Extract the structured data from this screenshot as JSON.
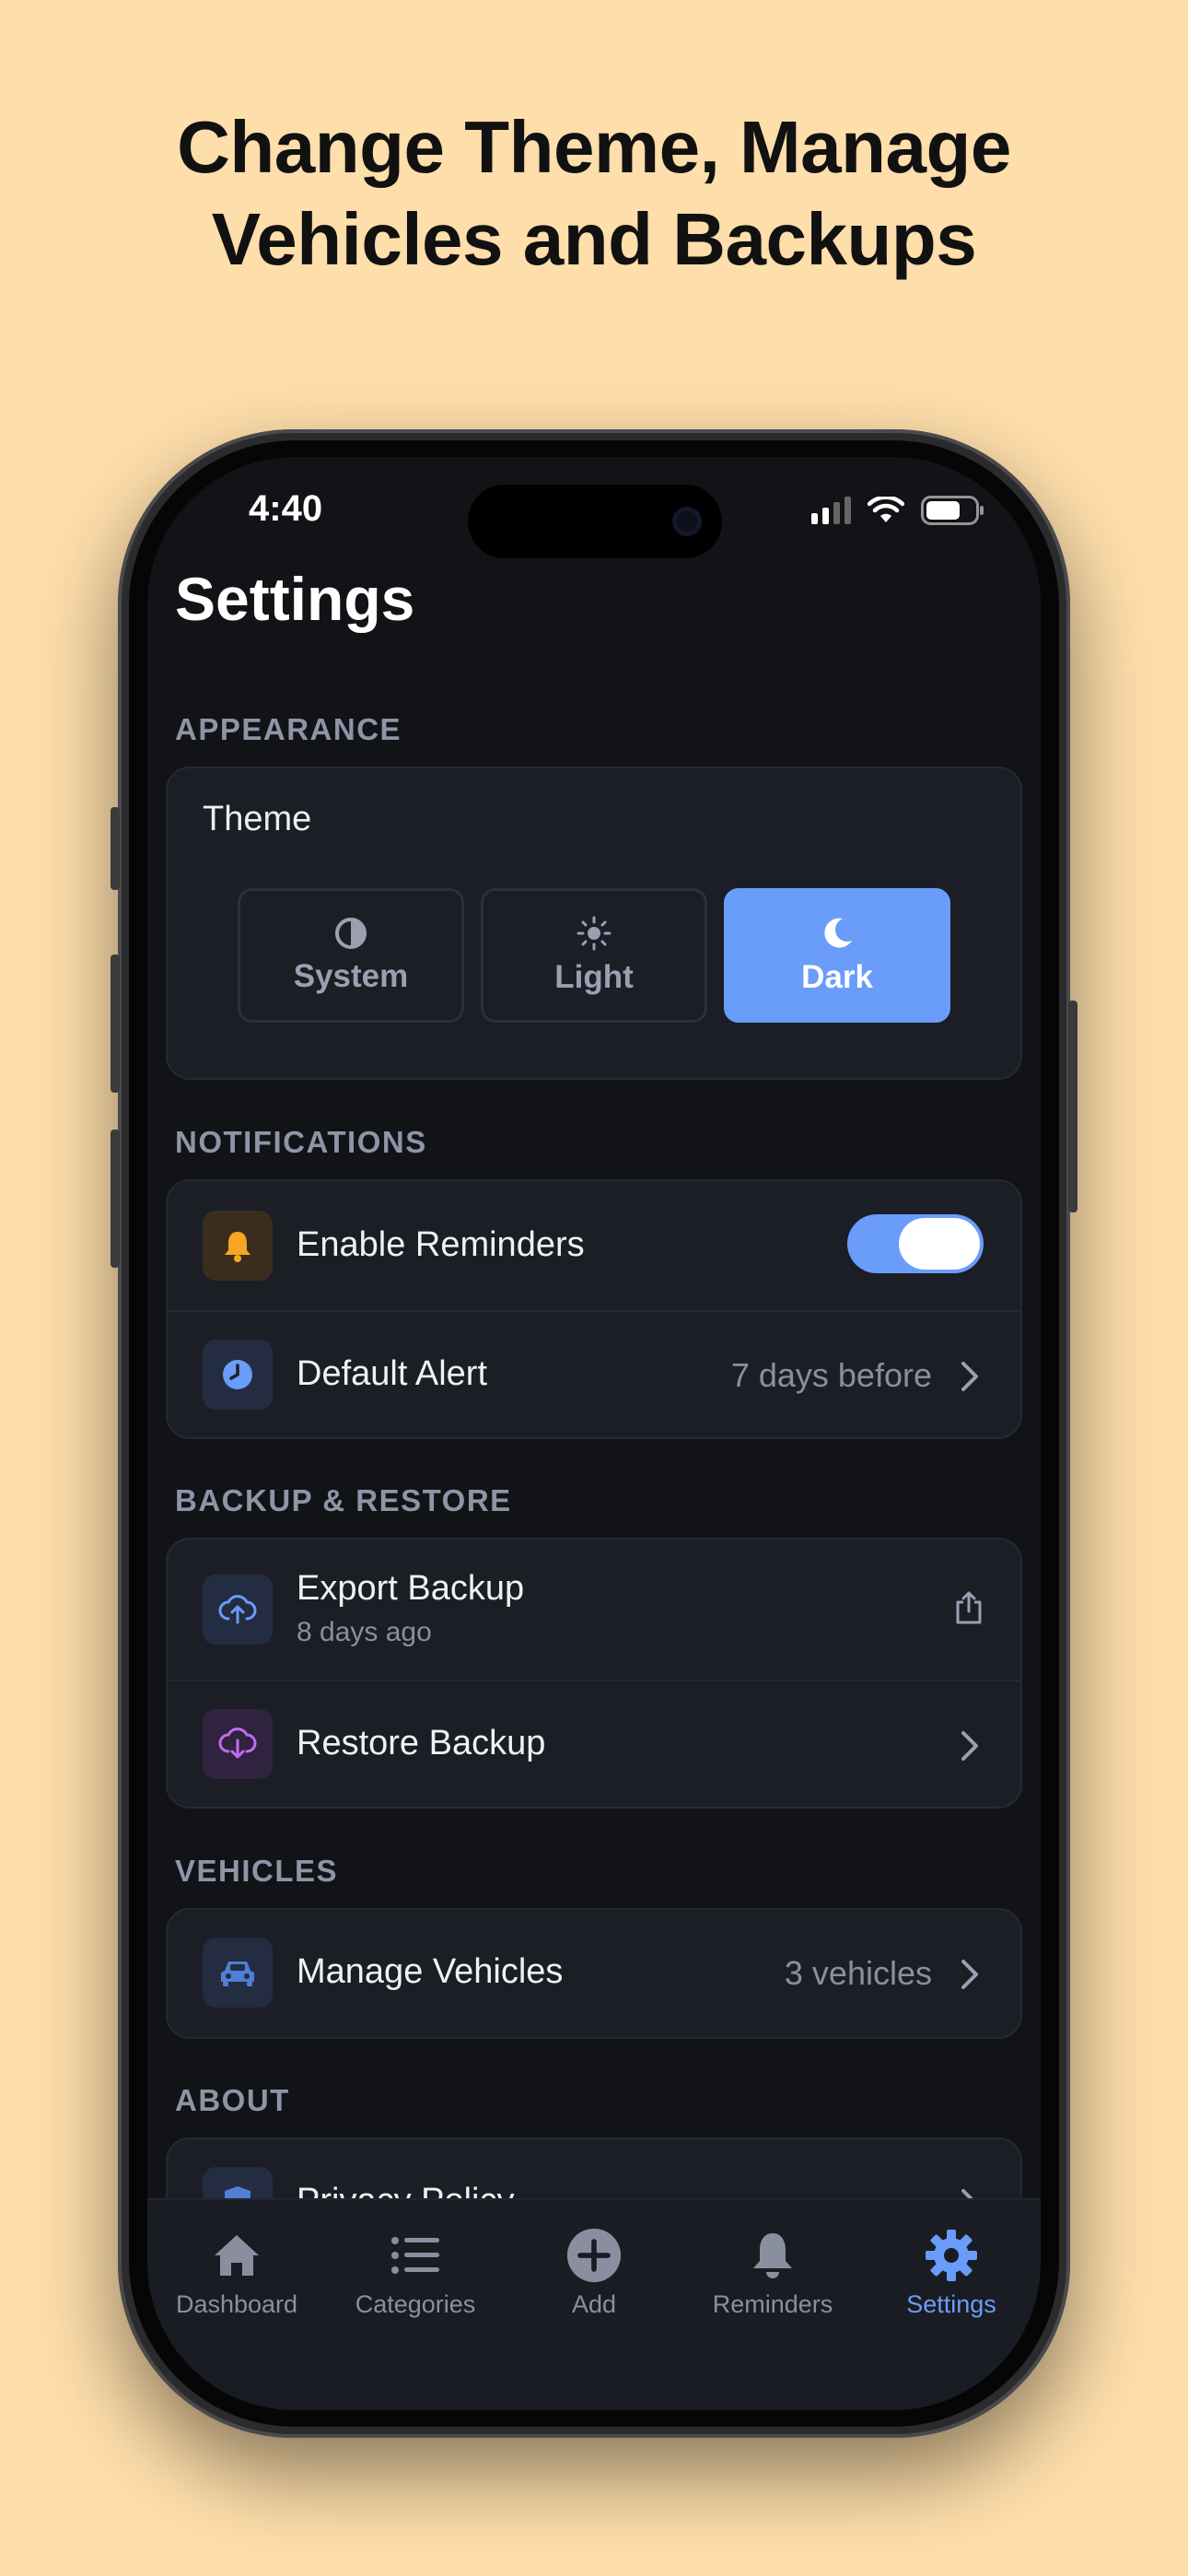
{
  "headline": {
    "line1": "Change Theme, Manage",
    "line2": "Vehicles and Backups"
  },
  "status_bar": {
    "time": "4:40"
  },
  "page_title": "Settings",
  "sections": {
    "appearance": {
      "label": "APPEARANCE",
      "theme_label": "Theme",
      "options": [
        {
          "label": "System",
          "icon": "half-circle-icon"
        },
        {
          "label": "Light",
          "icon": "sun-icon"
        },
        {
          "label": "Dark",
          "icon": "moon-icon"
        }
      ],
      "selected": "Dark"
    },
    "notifications": {
      "label": "NOTIFICATIONS",
      "enable_reminders": {
        "title": "Enable Reminders",
        "icon": "bell-icon",
        "enabled": true
      },
      "default_alert": {
        "title": "Default Alert",
        "value": "7 days before",
        "icon": "clock-icon"
      }
    },
    "backup": {
      "label": "BACKUP & RESTORE",
      "export": {
        "title": "Export Backup",
        "subtitle": "8 days ago",
        "icon": "cloud-upload-icon"
      },
      "restore": {
        "title": "Restore Backup",
        "icon": "cloud-download-icon"
      }
    },
    "vehicles": {
      "label": "VEHICLES",
      "manage": {
        "title": "Manage Vehicles",
        "value": "3 vehicles",
        "icon": "car-icon"
      }
    },
    "about": {
      "label": "ABOUT",
      "privacy": {
        "title": "Privacy Policy",
        "icon": "shield-icon"
      }
    }
  },
  "tabbar": {
    "tabs": [
      {
        "label": "Dashboard",
        "icon": "home-icon"
      },
      {
        "label": "Categories",
        "icon": "list-icon"
      },
      {
        "label": "Add",
        "icon": "plus-circle-icon"
      },
      {
        "label": "Reminders",
        "icon": "bell-icon"
      },
      {
        "label": "Settings",
        "icon": "gear-icon"
      }
    ],
    "active": "Settings"
  },
  "colors": {
    "background": "#FEDEAA",
    "screen": "#121317",
    "card": "#1c1e26",
    "accent": "#6a9cf9",
    "muted": "#8a8fa0"
  }
}
